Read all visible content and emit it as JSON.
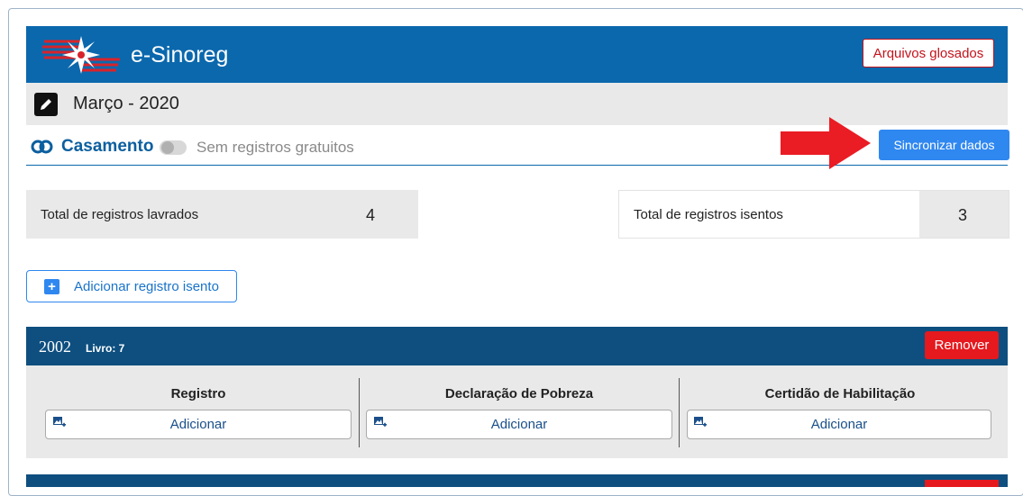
{
  "app": {
    "title": "e-Sinoreg",
    "glosados_label": "Arquivos glosados"
  },
  "period": {
    "label": "Março - 2020"
  },
  "section": {
    "title": "Casamento",
    "toggle_label": "Sem registros gratuitos",
    "sync_label": "Sincronizar dados"
  },
  "stats": {
    "lavrados_label": "Total de registros lavrados",
    "lavrados_value": "4",
    "isentos_label": "Total de registros isentos",
    "isentos_value": "3"
  },
  "add_isento_label": "Adicionar registro isento",
  "record": {
    "year": "2002",
    "livro": "Livro: 7",
    "remove_label": "Remover",
    "documents": [
      {
        "title": "Registro",
        "add_label": "Adicionar"
      },
      {
        "title": "Declaração de Pobreza",
        "add_label": "Adicionar"
      },
      {
        "title": "Certidão de Habilitação",
        "add_label": "Adicionar"
      }
    ]
  },
  "colors": {
    "header": "#0b68ad",
    "record_bar": "#0e4f7f",
    "danger": "#e5191e",
    "primary": "#2f87f0"
  },
  "icons": [
    "logo-icon",
    "edit-icon",
    "rings-icon",
    "plus-icon",
    "image-add-icon"
  ]
}
